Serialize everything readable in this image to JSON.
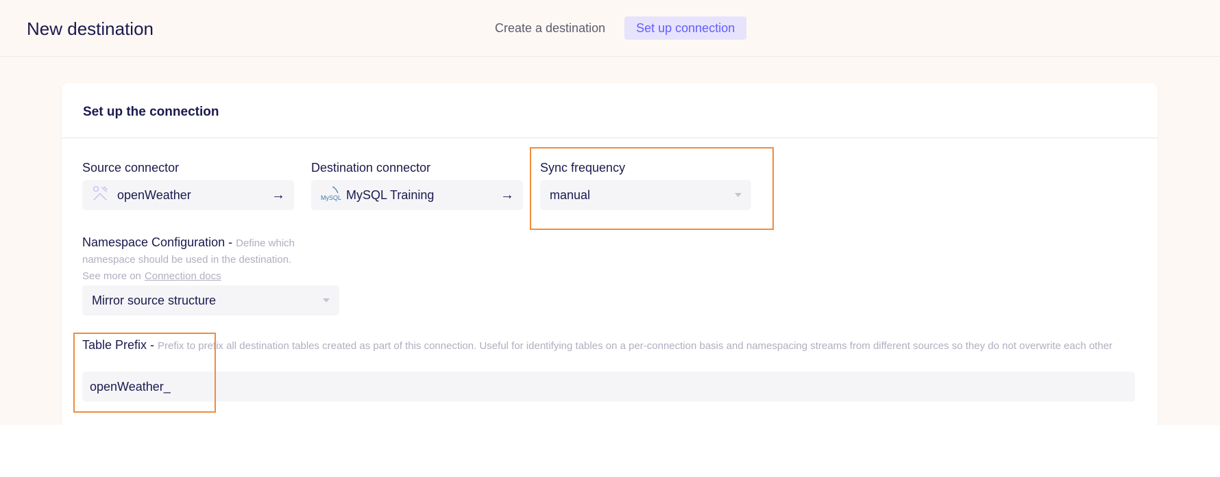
{
  "header": {
    "title": "New destination",
    "steps": [
      {
        "label": "Create a destination",
        "active": false
      },
      {
        "label": "Set up connection",
        "active": true
      }
    ]
  },
  "card": {
    "title": "Set up the connection"
  },
  "source": {
    "label": "Source connector",
    "name": "openWeather",
    "icon": "tools-icon"
  },
  "destination": {
    "label": "Destination connector",
    "name": "MySQL Training",
    "icon": "mysql-logo-icon",
    "logo_text": "MySQL"
  },
  "sync": {
    "label": "Sync frequency",
    "value": "manual"
  },
  "namespace": {
    "label": "Namespace Configuration",
    "separator": " - ",
    "hint": "Define which namespace should be used in the destination.",
    "hint_more": "See more on",
    "link": "Connection docs",
    "value": "Mirror source structure"
  },
  "prefix": {
    "label": "Table Prefix",
    "separator": " - ",
    "hint": "Prefix to prefix all destination tables created as part of this connection. Useful for identifying tables on a per-connection basis and namespacing streams from different sources so they do not overwrite each other",
    "value": "openWeather_"
  },
  "colors": {
    "accent": "#615eff",
    "highlight": "#f08b3b",
    "background": "#fdf8f3",
    "text": "#1a194d"
  }
}
